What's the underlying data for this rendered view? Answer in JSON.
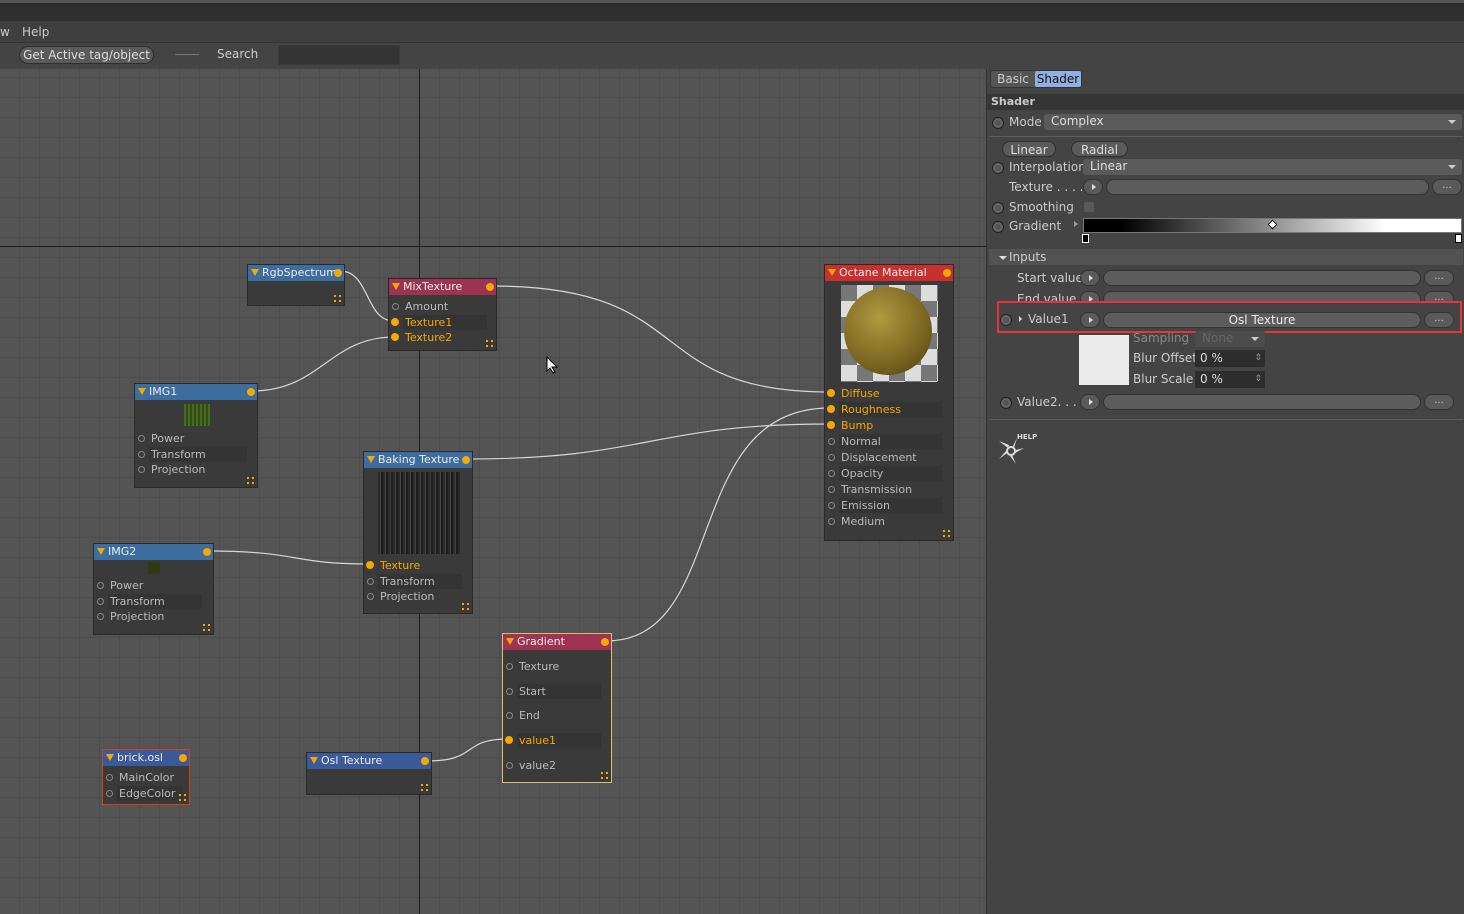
{
  "menubar": {
    "items": [
      "w",
      "Help"
    ]
  },
  "toolbar": {
    "get_active_label": "Get Active tag/object",
    "search_label": "Search",
    "search_value": ""
  },
  "nodes": [
    {
      "id": "rgb",
      "title": "RgbSpectrum",
      "header_color": "#3c6d9e",
      "inputs": []
    },
    {
      "id": "mix",
      "title": "MixTexture",
      "header_color": "#9c3352",
      "inputs": [
        {
          "label": "Amount",
          "connected": false
        },
        {
          "label": "Texture1",
          "connected": true
        },
        {
          "label": "Texture2",
          "connected": true
        }
      ]
    },
    {
      "id": "img1",
      "title": "IMG1",
      "header_color": "#3c6d9e",
      "inputs": [
        {
          "label": "Power",
          "connected": false
        },
        {
          "label": "Transform",
          "connected": false
        },
        {
          "label": "Projection",
          "connected": false
        }
      ]
    },
    {
      "id": "bake",
      "title": "Baking Texture",
      "header_color": "#3c6d9e",
      "inputs": [
        {
          "label": "Texture",
          "connected": true
        },
        {
          "label": "Transform",
          "connected": false
        },
        {
          "label": "Projection",
          "connected": false
        }
      ]
    },
    {
      "id": "img2",
      "title": "IMG2",
      "header_color": "#3c6d9e",
      "inputs": [
        {
          "label": "Power",
          "connected": false
        },
        {
          "label": "Transform",
          "connected": false
        },
        {
          "label": "Projection",
          "connected": false
        }
      ]
    },
    {
      "id": "grad",
      "title": "Gradient",
      "header_color": "#a03352",
      "inputs": [
        {
          "label": "Texture",
          "connected": false
        },
        {
          "label": "Start",
          "connected": false
        },
        {
          "label": "End",
          "connected": false
        },
        {
          "label": "value1",
          "connected": true
        },
        {
          "label": "value2",
          "connected": false
        }
      ]
    },
    {
      "id": "brick",
      "title": "brick.osl",
      "header_color": "#3a5a9a",
      "inputs": [
        {
          "label": "MainColor",
          "connected": false
        },
        {
          "label": "EdgeColor",
          "connected": false
        }
      ]
    },
    {
      "id": "osl",
      "title": "Osl Texture",
      "header_color": "#3a5a9a",
      "inputs": []
    },
    {
      "id": "octane",
      "title": "Octane Material",
      "header_color": "#c8302e",
      "inputs": [
        {
          "label": "Diffuse",
          "connected": true
        },
        {
          "label": "Roughness",
          "connected": true
        },
        {
          "label": "Bump",
          "connected": true
        },
        {
          "label": "Normal",
          "connected": false
        },
        {
          "label": "Displacement",
          "connected": false
        },
        {
          "label": "Opacity",
          "connected": false
        },
        {
          "label": "Transmission",
          "connected": false
        },
        {
          "label": "Emission",
          "connected": false
        },
        {
          "label": "Medium",
          "connected": false
        }
      ]
    }
  ],
  "panel": {
    "tabs": [
      {
        "label": "Basic",
        "active": false
      },
      {
        "label": "Shader",
        "active": true
      }
    ],
    "section_title": "Shader",
    "mode_label": "Mode",
    "mode_value": "Complex",
    "linear_btn": "Linear",
    "radial_btn": "Radial",
    "interpolation_label": "Interpolation",
    "interpolation_value": "Linear",
    "texture_label": "Texture . . . .",
    "smoothing_label": "Smoothing",
    "smoothing_checked": false,
    "gradient_label": "Gradient",
    "inputs_label": "Inputs",
    "start_label": "Start value",
    "end_label": "End value",
    "value1_label": "Value1",
    "value1_field": "Osl Texture",
    "sampling_label": "Sampling",
    "sampling_value": "None",
    "blur_offset_label": "Blur Offset",
    "blur_offset_value": "0 %",
    "blur_scale_label": "Blur Scale",
    "blur_scale_value": "0 %",
    "value2_label": "Value2. . .",
    "dots": "...",
    "help_label": "HELP",
    "highlight_color": "#e8323c"
  }
}
